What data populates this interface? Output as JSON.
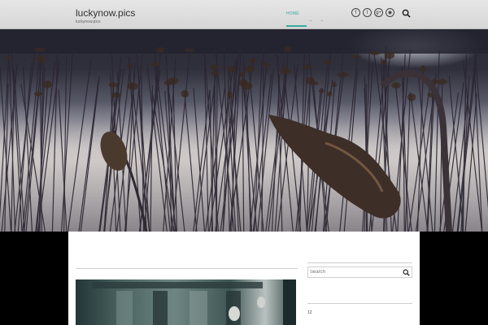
{
  "header": {
    "site_title": "luckynow.pics",
    "site_tagline": "luckynow.pics",
    "nav": {
      "home_label": "HOME",
      "chevrons": "⌄ ⌄"
    },
    "social": [
      {
        "icon": "facebook-icon",
        "glyph": "f"
      },
      {
        "icon": "twitter-icon",
        "glyph": "t"
      },
      {
        "icon": "google-plus-icon",
        "glyph": "g+"
      },
      {
        "icon": "rss-icon",
        "glyph": "◉"
      }
    ],
    "search_icon": "search-icon"
  },
  "sidebar": {
    "search_placeholder": "Search",
    "widget_number": "12"
  },
  "colors": {
    "accent": "#3aa7a0",
    "header_bg": "#dcdcdc",
    "page_bg": "#000000",
    "content_bg": "#ffffff"
  }
}
